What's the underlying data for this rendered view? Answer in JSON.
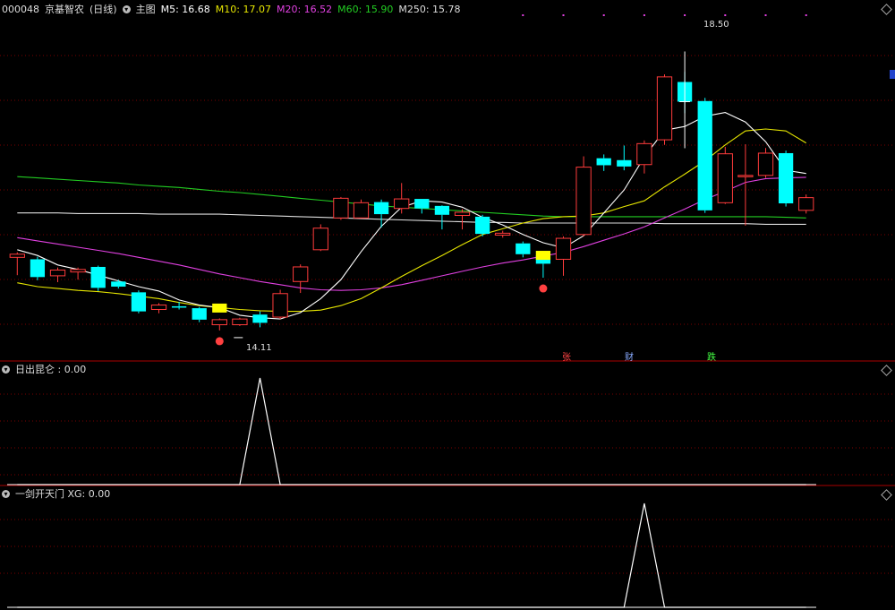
{
  "header_main": {
    "code": "000048",
    "name": "京基智农",
    "period": "(日线)",
    "panel": "主图",
    "ma": [
      {
        "label": "M5: 16.68",
        "color": "#ffffff"
      },
      {
        "label": "M10: 17.07",
        "color": "#e6e600"
      },
      {
        "label": "M20: 16.52",
        "color": "#e040e0"
      },
      {
        "label": "M60: 15.90",
        "color": "#22cc22"
      },
      {
        "label": "M250: 15.78",
        "color": "#dddddd"
      }
    ]
  },
  "indicator1": {
    "label": "日出昆仑 : 0.00"
  },
  "indicator2": {
    "label": "一剑开天门 XG: 0.00"
  },
  "annotations": {
    "high_label": "18.50",
    "low_label": "14.11",
    "zhang": "张",
    "cai": "财",
    "die": "跌"
  },
  "colors": {
    "up": "#ff3b3b",
    "down": "#00ffff",
    "ma5": "#ffffff",
    "ma10": "#e6e600",
    "ma20": "#e040e0",
    "ma60": "#22cc22",
    "ma250": "#dddddd",
    "grid": "#7a0000"
  },
  "chart_data": [
    {
      "type": "candlestick",
      "ylim": [
        13.7,
        19.0
      ],
      "candles": [
        [
          15.26,
          15.31,
          14.98,
          15.34
        ],
        [
          15.23,
          14.95,
          14.9,
          15.27
        ],
        [
          14.97,
          15.06,
          14.87,
          15.1
        ],
        [
          15.03,
          15.07,
          14.91,
          15.1
        ],
        [
          15.11,
          14.78,
          14.73,
          15.13
        ],
        [
          14.88,
          14.8,
          14.77,
          14.91
        ],
        [
          14.71,
          14.41,
          14.38,
          14.74
        ],
        [
          14.44,
          14.51,
          14.38,
          14.54
        ],
        [
          14.49,
          14.48,
          14.44,
          14.56
        ],
        [
          14.46,
          14.28,
          14.24,
          14.48
        ],
        [
          14.2,
          14.28,
          14.11,
          14.3
        ],
        [
          14.2,
          14.29,
          14.18,
          14.31
        ],
        [
          14.36,
          14.23,
          14.16,
          14.41
        ],
        [
          14.32,
          14.69,
          14.29,
          14.75
        ],
        [
          14.88,
          15.11,
          14.7,
          15.15
        ],
        [
          15.38,
          15.72,
          15.36,
          15.78
        ],
        [
          15.88,
          16.19,
          15.85,
          16.21
        ],
        [
          15.88,
          16.12,
          16.06,
          16.17
        ],
        [
          16.13,
          15.94,
          15.73,
          16.17
        ],
        [
          16.03,
          16.18,
          15.95,
          16.43
        ],
        [
          16.18,
          16.03,
          15.95,
          16.18
        ],
        [
          16.07,
          15.93,
          15.7,
          16.08
        ],
        [
          15.92,
          15.97,
          15.7,
          16.02
        ],
        [
          15.9,
          15.63,
          15.59,
          15.93
        ],
        [
          15.61,
          15.64,
          15.57,
          15.68
        ],
        [
          15.48,
          15.31,
          15.26,
          15.51
        ],
        [
          15.29,
          15.16,
          14.94,
          15.34
        ],
        [
          15.23,
          15.56,
          14.97,
          15.59
        ],
        [
          15.62,
          16.68,
          15.59,
          16.85
        ],
        [
          16.82,
          16.71,
          16.62,
          16.88
        ],
        [
          16.79,
          16.69,
          16.63,
          17.02
        ],
        [
          16.72,
          17.05,
          16.58,
          17.1
        ],
        [
          17.11,
          18.1,
          17.03,
          18.14
        ],
        [
          18.02,
          17.71,
          17.53,
          18.18
        ],
        [
          17.72,
          16.0,
          15.96,
          17.77
        ],
        [
          16.12,
          16.89,
          16.1,
          17.0
        ],
        [
          16.53,
          16.55,
          15.76,
          17.04
        ],
        [
          16.55,
          16.9,
          16.51,
          16.98
        ],
        [
          16.9,
          16.11,
          16.06,
          16.94
        ],
        [
          16.0,
          16.2,
          15.95,
          16.25
        ]
      ],
      "ma5": [
        15.38,
        15.29,
        15.14,
        15.07,
        14.98,
        14.89,
        14.8,
        14.73,
        14.59,
        14.51,
        14.47,
        14.35,
        14.31,
        14.29,
        14.39,
        14.61,
        14.91,
        15.35,
        15.75,
        16.05,
        16.15,
        16.13,
        16.05,
        15.89,
        15.77,
        15.62,
        15.49,
        15.41,
        15.6,
        15.96,
        16.32,
        16.84,
        17.26,
        17.32,
        17.48,
        17.54,
        17.39,
        17.08,
        16.63,
        16.58
      ],
      "ma10": [
        14.86,
        14.8,
        14.77,
        14.74,
        14.72,
        14.69,
        14.65,
        14.61,
        14.55,
        14.5,
        14.47,
        14.44,
        14.42,
        14.41,
        14.41,
        14.43,
        14.5,
        14.61,
        14.78,
        14.96,
        15.13,
        15.29,
        15.46,
        15.62,
        15.71,
        15.8,
        15.87,
        15.9,
        15.91,
        15.96,
        16.06,
        16.15,
        16.37,
        16.57,
        16.78,
        17.03,
        17.25,
        17.28,
        17.25,
        17.06
      ],
      "ma20": [
        15.57,
        15.52,
        15.47,
        15.42,
        15.37,
        15.32,
        15.26,
        15.2,
        15.14,
        15.07,
        15.0,
        14.94,
        14.88,
        14.83,
        14.78,
        14.75,
        14.74,
        14.75,
        14.78,
        14.83,
        14.9,
        14.97,
        15.04,
        15.11,
        15.17,
        15.22,
        15.28,
        15.34,
        15.43,
        15.53,
        15.63,
        15.74,
        15.88,
        16.02,
        16.17,
        16.3,
        16.44,
        16.5,
        16.51,
        16.52
      ],
      "ma60": [
        16.53,
        16.51,
        16.49,
        16.47,
        16.45,
        16.43,
        16.4,
        16.38,
        16.36,
        16.33,
        16.3,
        16.28,
        16.25,
        16.22,
        16.19,
        16.16,
        16.13,
        16.1,
        16.07,
        16.05,
        16.03,
        16.01,
        15.99,
        15.97,
        15.95,
        15.93,
        15.91,
        15.9,
        15.9,
        15.9,
        15.9,
        15.9,
        15.9,
        15.9,
        15.9,
        15.9,
        15.9,
        15.9,
        15.89,
        15.88
      ],
      "ma250": [
        15.96,
        15.96,
        15.96,
        15.95,
        15.95,
        15.95,
        15.95,
        15.94,
        15.94,
        15.94,
        15.94,
        15.93,
        15.92,
        15.91,
        15.9,
        15.89,
        15.88,
        15.87,
        15.86,
        15.85,
        15.84,
        15.83,
        15.82,
        15.81,
        15.81,
        15.8,
        15.8,
        15.8,
        15.8,
        15.8,
        15.8,
        15.8,
        15.79,
        15.79,
        15.79,
        15.79,
        15.79,
        15.78,
        15.78,
        15.78
      ]
    },
    {
      "type": "line",
      "name": "日出昆仑",
      "ylim": [
        0,
        1
      ],
      "values": [
        0,
        0,
        0,
        0,
        0,
        0,
        0,
        0,
        0,
        0,
        0,
        0,
        1,
        0,
        0,
        0,
        0,
        0,
        0,
        0,
        0,
        0,
        0,
        0,
        0,
        0,
        0,
        0,
        0,
        0,
        0,
        0,
        0,
        0,
        0,
        0,
        0,
        0,
        0,
        0
      ]
    },
    {
      "type": "line",
      "name": "一剑开天门 XG",
      "ylim": [
        0,
        1
      ],
      "values": [
        0,
        0,
        0,
        0,
        0,
        0,
        0,
        0,
        0,
        0,
        0,
        0,
        0,
        0,
        0,
        0,
        0,
        0,
        0,
        0,
        0,
        0,
        0,
        0,
        0,
        0,
        0,
        0,
        0,
        0,
        0,
        1,
        0,
        0,
        0,
        0,
        0,
        0,
        0,
        0
      ]
    }
  ]
}
